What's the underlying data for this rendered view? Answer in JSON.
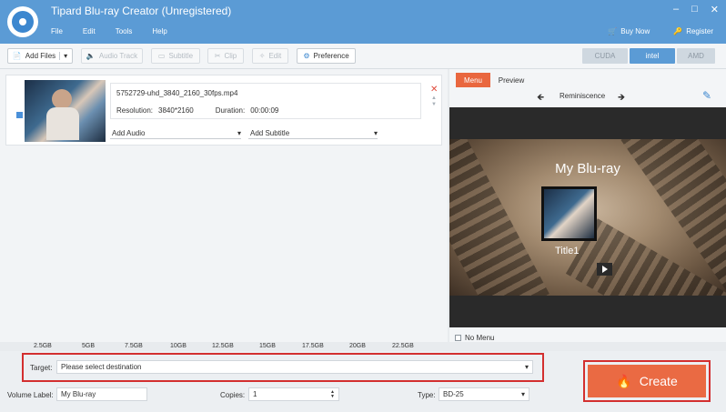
{
  "app": {
    "title": "Tipard Blu-ray Creator (Unregistered)"
  },
  "menu": [
    "File",
    "Edit",
    "Tools",
    "Help"
  ],
  "window": {
    "minimize": "–",
    "maximize": "□",
    "close": "✕"
  },
  "topright": {
    "buy": "Buy Now",
    "register": "Register"
  },
  "toolbar": {
    "add_files": "Add Files",
    "audio_track": "Audio Track",
    "subtitle": "Subtitle",
    "clip": "Clip",
    "edit": "Edit",
    "preference": "Preference",
    "gpu": [
      "CUDA",
      "intel",
      "AMD"
    ]
  },
  "file": {
    "name": "5752729-uhd_3840_2160_30fps.mp4",
    "resolution_label": "Resolution:",
    "resolution": "3840*2160",
    "duration_label": "Duration:",
    "duration": "00:00:09",
    "add_audio": "Add Audio",
    "add_subtitle": "Add Subtitle"
  },
  "right": {
    "tabs": [
      "Menu",
      "Preview"
    ],
    "theme": "Reminiscence",
    "menu_title": "My Blu-ray",
    "menu_caption": "Title1",
    "no_menu": "No Menu"
  },
  "capacity": [
    "2.5GB",
    "5GB",
    "7.5GB",
    "10GB",
    "12.5GB",
    "15GB",
    "17.5GB",
    "20GB",
    "22.5GB"
  ],
  "target": {
    "label": "Target:",
    "value": "Please select destination"
  },
  "volume": {
    "label": "Volume Label:",
    "value": "My Blu-ray"
  },
  "copies": {
    "label": "Copies:",
    "value": "1"
  },
  "type": {
    "label": "Type:",
    "value": "BD-25"
  },
  "create": {
    "label": "Create"
  },
  "colors": {
    "accent": "#ea6a43",
    "titlebar": "#5b9bd5",
    "highlight": "#d32f2f"
  }
}
